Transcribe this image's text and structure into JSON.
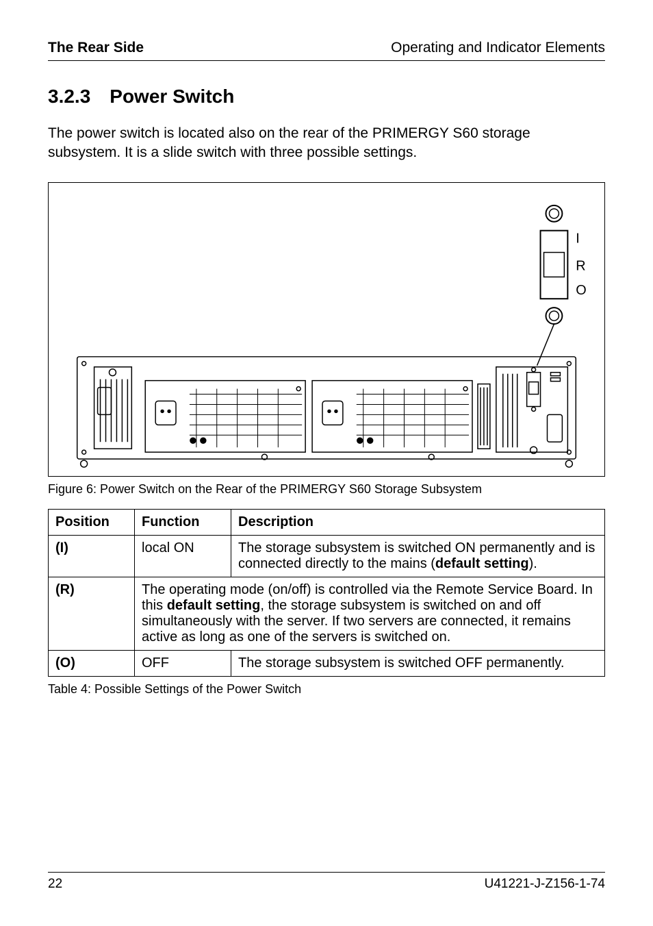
{
  "header": {
    "left": "The Rear Side",
    "right": "Operating and Indicator Elements"
  },
  "section": {
    "number": "3.2.3",
    "title": "Power Switch"
  },
  "intro": "The power switch is located also on the rear of the PRIMERGY S60 storage subsystem. It is a slide switch with three possible settings.",
  "figure": {
    "caption": "Figure 6: Power Switch on the Rear of the PRIMERGY S60 Storage Subsystem",
    "switch_labels": {
      "top": "I",
      "mid": "R",
      "bot": "O"
    }
  },
  "table": {
    "headers": {
      "position": "Position",
      "function": "Function",
      "description": "Description"
    },
    "rows": [
      {
        "position": "(I)",
        "function": "local ON",
        "desc_pre": "The storage subsystem is switched ON permanently and is connected directly to the mains (",
        "desc_bold": "default setting",
        "desc_post": ")."
      },
      {
        "position": "(R)",
        "span_pre": "The operating mode (on/off) is controlled via the Remote Service Board. In this ",
        "span_bold": "default setting",
        "span_post": ", the storage subsystem is switched on and off simultaneously with the server. If two servers are connected, it remains active as long as one of the servers is switched on."
      },
      {
        "position": "(O)",
        "function": "OFF",
        "description": "The storage subsystem is switched OFF permanently."
      }
    ],
    "caption": "Table 4:  Possible Settings of the Power Switch"
  },
  "footer": {
    "left": "22",
    "right": "U41221-J-Z156-1-74"
  }
}
